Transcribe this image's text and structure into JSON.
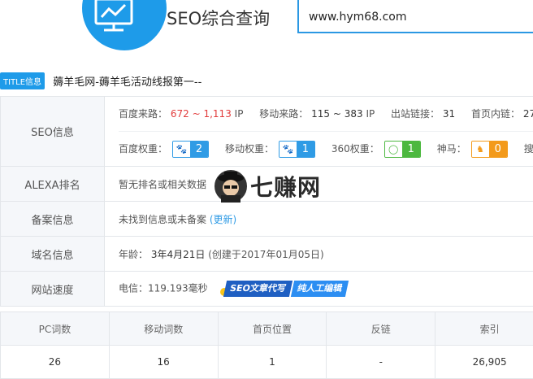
{
  "header": {
    "site_title": "SEO综合查询",
    "search_value": "www.hym68.com"
  },
  "title_row": {
    "badge": "TITLE信息",
    "text": "薅羊毛网-薅羊毛活动线报第一--"
  },
  "seo": {
    "label": "SEO信息",
    "baidu_source_label": "百度来路：",
    "baidu_source_min": "672",
    "baidu_source_sep": "~",
    "baidu_source_max": "1,113",
    "baidu_source_unit": "IP",
    "mobile_source_label": "移动来路：",
    "mobile_source_value": "115 ~ 383",
    "mobile_source_unit": "IP",
    "outbound_label": "出站链接：",
    "outbound_value": "31",
    "inner_label": "首页内链：",
    "inner_value": "27",
    "baidu_weight_label": "百度权重：",
    "baidu_weight_value": "2",
    "mobile_weight_label": "移动权重：",
    "mobile_weight_value": "1",
    "w360_label": "360权重：",
    "w360_value": "1",
    "shenma_label": "神马：",
    "shenma_value": "0",
    "sogou_label": "搜狗"
  },
  "alexa": {
    "label": "ALEXA排名",
    "value": "暂无排名或相关数据"
  },
  "beian": {
    "label": "备案信息",
    "value": "未找到信息或未备案",
    "link": "(更新)"
  },
  "domain": {
    "label": "域名信息",
    "age_label": "年龄：",
    "age_value": "3年4月21日",
    "created": "(创建于2017年01月05日)"
  },
  "speed": {
    "label": "网站速度",
    "value": "电信：119.193毫秒",
    "banner_left": "SEO文章代写",
    "banner_right": "纯人工编辑"
  },
  "watermark": {
    "text": "七赚网"
  },
  "stats": {
    "headers": [
      "PC词数",
      "移动词数",
      "首页位置",
      "反链",
      "索引"
    ],
    "values": [
      "26",
      "16",
      "1",
      "-",
      "26,905"
    ]
  },
  "colors": {
    "accent": "#1e9be9",
    "red": "#e23c3c",
    "green": "#4cb83f",
    "orange": "#f39a1b"
  }
}
